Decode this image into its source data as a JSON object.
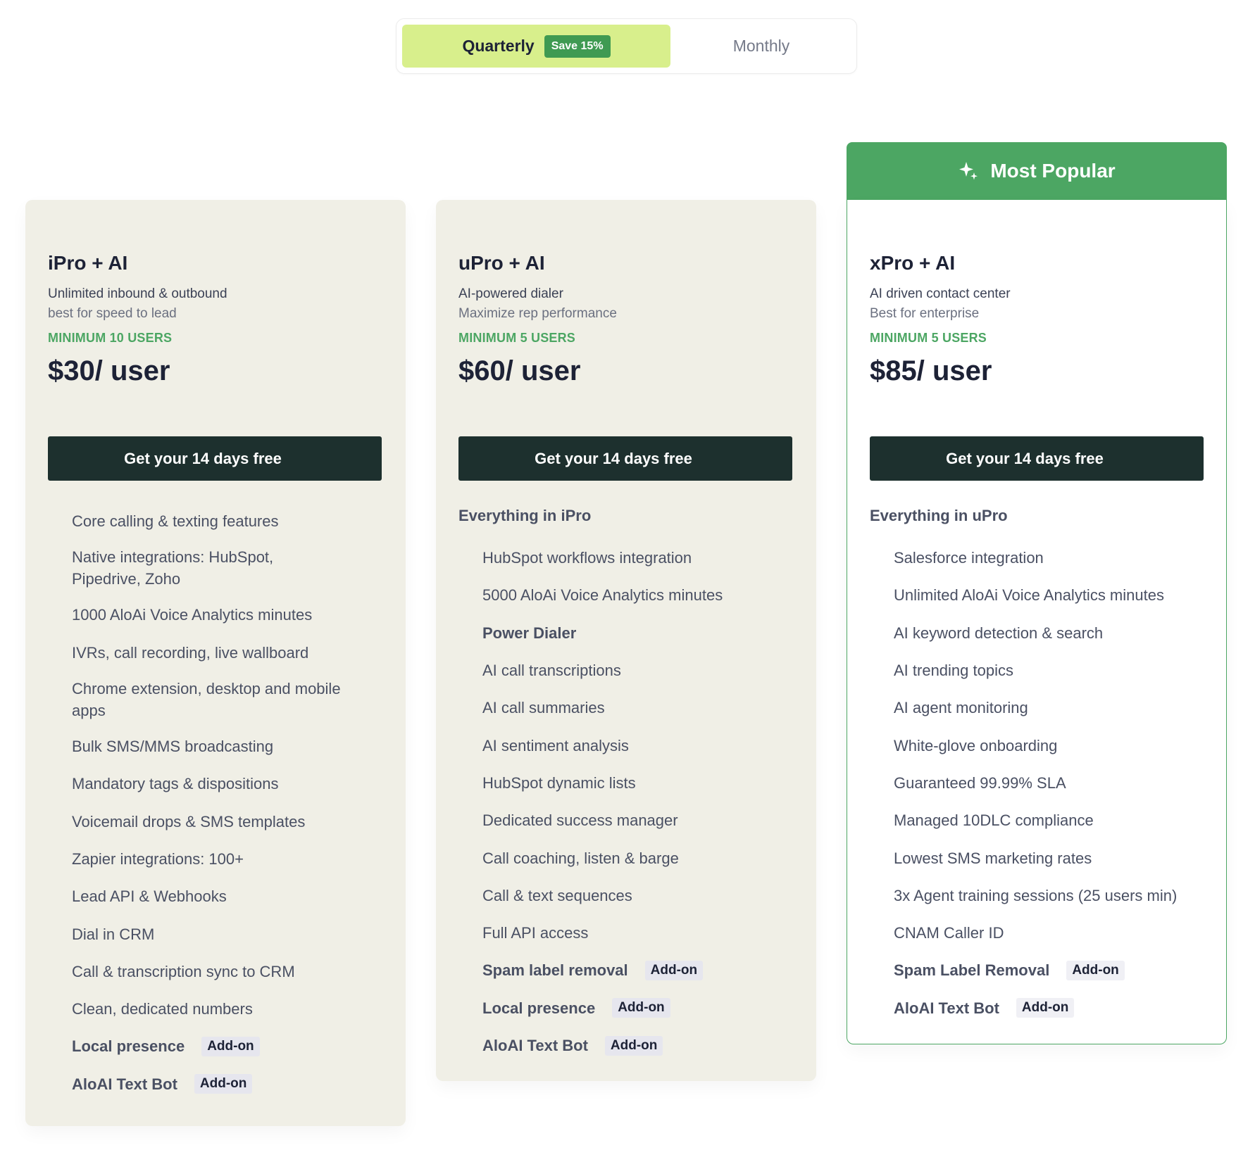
{
  "billing_toggle": {
    "quarterly_label": "Quarterly",
    "save_badge": "Save 15%",
    "monthly_label": "Monthly",
    "selected": "Quarterly"
  },
  "popular_banner": {
    "label": "Most Popular"
  },
  "colors": {
    "accent_green": "#4ca663",
    "toggle_active": "#d8ef8c",
    "cta_dark": "#1d302e",
    "card_bg": "#f0efe6"
  },
  "plans": [
    {
      "name": "iPro + AI",
      "description": "Unlimited inbound & outbound",
      "subdescription": "best for speed to lead",
      "minimum_users": "MINIMUM 10 USERS",
      "price": "$30/ user",
      "cta_label": "Get your 14 days free",
      "features": [
        {
          "text": "Core calling & texting features"
        },
        {
          "text": "Native integrations: HubSpot, Pipedrive, Zoho",
          "info": true
        },
        {
          "text": "1000 AloAi Voice Analytics minutes"
        },
        {
          "text": "IVRs, call recording, live wallboard"
        },
        {
          "text": "Chrome extension, desktop and mobile apps"
        },
        {
          "text": "Bulk SMS/MMS broadcasting"
        },
        {
          "text": "Mandatory tags & dispositions"
        },
        {
          "text": "Voicemail drops & SMS templates"
        },
        {
          "text": "Zapier integrations: 100+"
        },
        {
          "text": "Lead API & Webhooks"
        },
        {
          "text": "Dial in CRM"
        },
        {
          "text": "Call & transcription sync to CRM"
        },
        {
          "text": "Clean, dedicated numbers"
        },
        {
          "text": "Local presence",
          "addon": "Add-on"
        },
        {
          "text": "AloAI Text Bot",
          "addon": "Add-on"
        }
      ]
    },
    {
      "name": "uPro + AI",
      "description": "AI-powered dialer",
      "subdescription": "Maximize rep performance",
      "minimum_users": "MINIMUM 5 USERS",
      "price": "$60/ user",
      "cta_label": "Get your 14 days free",
      "everything_in": "Everything in iPro",
      "features": [
        {
          "text": "HubSpot workflows integration",
          "info": true
        },
        {
          "text": "5000 AloAi Voice Analytics minutes"
        },
        {
          "text": "Power Dialer",
          "bold": true
        },
        {
          "text": "AI call transcriptions"
        },
        {
          "text": "AI call summaries"
        },
        {
          "text": "AI sentiment analysis"
        },
        {
          "text": "HubSpot dynamic lists",
          "info": true
        },
        {
          "text": "Dedicated success manager",
          "info": true
        },
        {
          "text": "Call coaching, listen & barge"
        },
        {
          "text": "Call & text sequences"
        },
        {
          "text": "Full API access"
        },
        {
          "text": "Spam label removal",
          "addon": "Add-on"
        },
        {
          "text": "Local presence",
          "addon": "Add-on"
        },
        {
          "text": "AloAI Text Bot",
          "addon": "Add-on"
        }
      ]
    },
    {
      "name": "xPro + AI",
      "description": "AI driven contact center",
      "subdescription": "Best for enterprise",
      "minimum_users": "MINIMUM 5 USERS",
      "price": "$85/ user",
      "cta_label": "Get your 14 days free",
      "everything_in": "Everything in uPro",
      "features": [
        {
          "text": "Salesforce integration"
        },
        {
          "text": "Unlimited AloAi Voice Analytics minutes"
        },
        {
          "text": "AI keyword detection & search"
        },
        {
          "text": "AI trending topics"
        },
        {
          "text": "AI agent monitoring"
        },
        {
          "text": "White-glove onboarding",
          "info": true
        },
        {
          "text": "Guaranteed 99.99% SLA"
        },
        {
          "text": "Managed 10DLC compliance"
        },
        {
          "text": "Lowest SMS marketing rates"
        },
        {
          "text": "3x Agent training sessions (25 users min)"
        },
        {
          "text": "CNAM Caller ID"
        },
        {
          "text": "Spam Label Removal",
          "addon": "Add-on"
        },
        {
          "text": "AloAI Text Bot",
          "addon": "Add-on"
        }
      ]
    }
  ]
}
